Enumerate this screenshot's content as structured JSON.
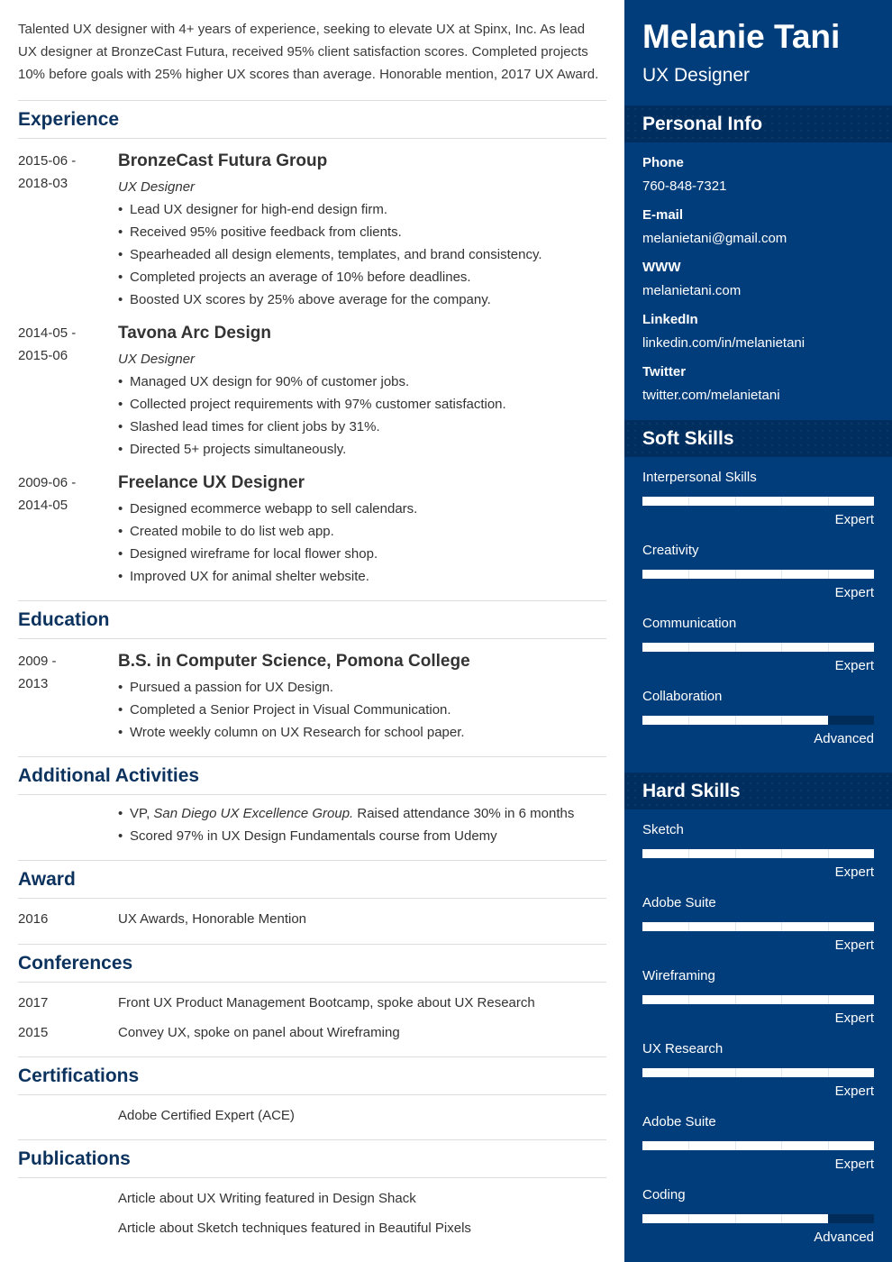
{
  "summary": "Talented UX designer with 4+ years of experience, seeking to elevate UX at Spinx, Inc. As lead UX designer at BronzeCast Futura, received 95% client satisfaction scores. Completed projects 10% before goals with 25% higher UX scores than average. Honorable mention, 2017 UX Award.",
  "experience": {
    "title": "Experience",
    "jobs": [
      {
        "date_start": "2015-06 -",
        "date_end": "2018-03",
        "org": "BronzeCast Futura Group",
        "role": "UX Designer",
        "bullets": [
          "Lead UX designer for high-end design firm.",
          "Received 95% positive feedback from clients.",
          "Spearheaded all design elements, templates, and brand consistency.",
          "Completed projects an average of 10% before deadlines.",
          "Boosted UX scores by 25% above average for the company."
        ]
      },
      {
        "date_start": "2014-05 -",
        "date_end": "2015-06",
        "org": "Tavona Arc Design",
        "role": "UX Designer",
        "bullets": [
          "Managed UX design for 90% of customer jobs.",
          "Collected project requirements with 97% customer satisfaction.",
          "Slashed lead times for client jobs by 31%.",
          "Directed 5+ projects simultaneously."
        ]
      },
      {
        "date_start": "2009-06 -",
        "date_end": "2014-05",
        "org": "Freelance UX Designer",
        "bullets": [
          "Designed ecommerce webapp to sell calendars.",
          "Created mobile to do list web app.",
          "Designed wireframe for local flower shop.",
          "Improved UX for animal shelter website."
        ]
      }
    ]
  },
  "education": {
    "title": "Education",
    "date_start": "2009 -",
    "date_end": "2013",
    "degree": "B.S. in Computer Science, Pomona College",
    "bullets": [
      "Pursued a passion for UX Design.",
      "Completed a Senior Project in Visual Communication.",
      "Wrote weekly column on UX Research for school paper."
    ]
  },
  "activities": {
    "title": "Additional Activities",
    "item1_prefix": "VP, ",
    "item1_italic": "San Diego UX Excellence Group.",
    "item1_suffix": " Raised attendance 30% in 6 months",
    "item2": "Scored 97% in UX Design Fundamentals course from Udemy"
  },
  "award": {
    "title": "Award",
    "year": "2016",
    "text": "UX Awards, Honorable Mention"
  },
  "conferences": {
    "title": "Conferences",
    "items": [
      {
        "year": "2017",
        "text": "Front UX Product Management Bootcamp, spoke about UX Research"
      },
      {
        "year": "2015",
        "text": "Convey UX, spoke on panel about Wireframing"
      }
    ]
  },
  "certifications": {
    "title": "Certifications",
    "items": [
      "Adobe Certified Expert (ACE)"
    ]
  },
  "publications": {
    "title": "Publications",
    "items": [
      "Article about UX Writing featured in Design Shack",
      "Article about Sketch techniques featured in Beautiful Pixels"
    ]
  },
  "sidebar": {
    "name": "Melanie Tani",
    "job_title": "UX Designer",
    "colors": {
      "background": "#003d7a",
      "header_band": "#002f5f",
      "heading_text": "#0c325e"
    },
    "personal_info": {
      "title": "Personal Info",
      "fields": [
        {
          "label": "Phone",
          "value": "760-848-7321"
        },
        {
          "label": "E-mail",
          "value": "melanietani@gmail.com"
        },
        {
          "label": "WWW",
          "value": "melanietani.com"
        },
        {
          "label": "LinkedIn",
          "value": "linkedin.com/in/melanietani"
        },
        {
          "label": "Twitter",
          "value": "twitter.com/melanietani"
        }
      ]
    },
    "soft_skills": {
      "title": "Soft Skills",
      "items": [
        {
          "name": "Interpersonal Skills",
          "level": "Expert",
          "fraction": 1.0
        },
        {
          "name": "Creativity",
          "level": "Expert",
          "fraction": 1.0
        },
        {
          "name": "Communication",
          "level": "Expert",
          "fraction": 1.0
        },
        {
          "name": "Collaboration",
          "level": "Advanced",
          "fraction": 0.8
        }
      ]
    },
    "hard_skills": {
      "title": "Hard Skills",
      "items": [
        {
          "name": "Sketch",
          "level": "Expert",
          "fraction": 1.0
        },
        {
          "name": "Adobe Suite",
          "level": "Expert",
          "fraction": 1.0
        },
        {
          "name": "Wireframing",
          "level": "Expert",
          "fraction": 1.0
        },
        {
          "name": "UX Research",
          "level": "Expert",
          "fraction": 1.0
        },
        {
          "name": "Adobe Suite",
          "level": "Expert",
          "fraction": 1.0
        },
        {
          "name": "Coding",
          "level": "Advanced",
          "fraction": 0.8
        }
      ]
    }
  }
}
